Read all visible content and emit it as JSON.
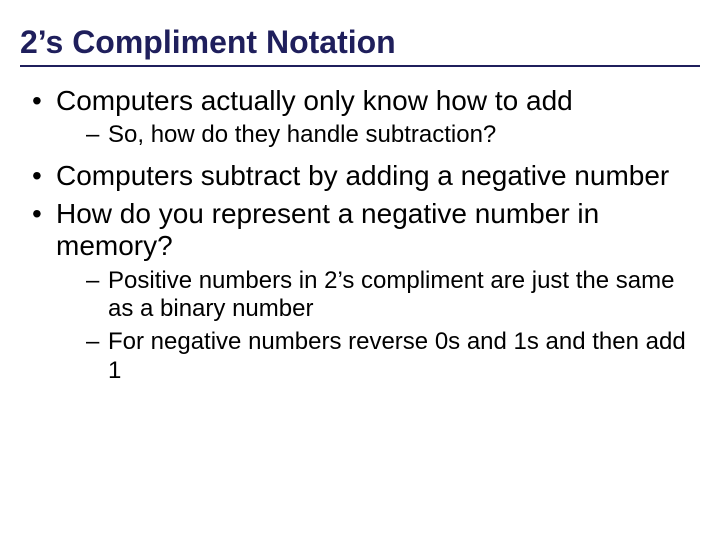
{
  "title": "2’s Compliment Notation",
  "bullets": [
    {
      "text": "Computers actually only know how to add",
      "sub": [
        "So, how do they handle subtraction?"
      ]
    },
    {
      "text": "Computers subtract by adding a negative number",
      "sub": []
    },
    {
      "text": "How do you represent a negative number in memory?",
      "sub": [
        "Positive numbers in 2’s compliment are just the same as a binary number",
        "For negative numbers reverse 0s and 1s and then add 1"
      ]
    }
  ]
}
